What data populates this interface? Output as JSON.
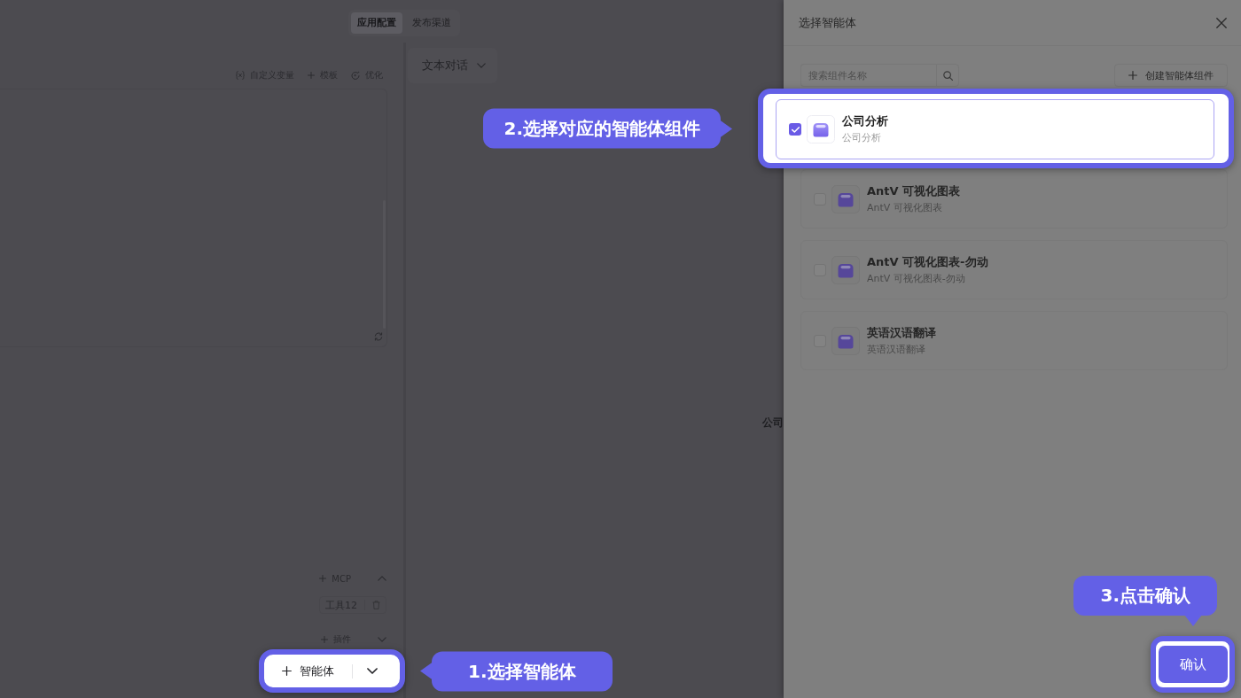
{
  "top_tabs": [
    {
      "label": "应用配置",
      "selected": true
    },
    {
      "label": "发布渠道",
      "selected": false
    }
  ],
  "prompt_panel": {
    "actions": [
      {
        "kind": "variable",
        "label": "自定义变量"
      },
      {
        "kind": "template",
        "label": "模板"
      },
      {
        "kind": "optimize",
        "label": "优化"
      }
    ]
  },
  "tool_groups": [
    {
      "label": "MCP",
      "expanded": true,
      "items": [
        {
          "label": "工具12"
        }
      ]
    },
    {
      "label": "插件",
      "expanded": false
    }
  ],
  "agent_button": {
    "label": "智能体",
    "spotlight": true,
    "guide": {
      "label": "1.选择智能体",
      "kind": "left"
    }
  },
  "chat_panel": {
    "mode": "文本对话",
    "preview_text": "公司"
  },
  "drawer": {
    "title": "选择智能体",
    "search": {
      "placeholder": "搜索组件名称"
    },
    "create_button": "创建智能体组件",
    "items": [
      {
        "name": "公司分析",
        "description": "公司分析",
        "checked": true,
        "spotlight": true,
        "guide": {
          "label": "2.选择对应的智能体组件",
          "kind": "right"
        }
      },
      {
        "name": "AntV 可视化图表",
        "description": "AntV 可视化图表",
        "checked": false,
        "spotlight": false
      },
      {
        "name": "AntV 可视化图表-勿动",
        "description": "AntV 可视化图表-勿动",
        "checked": false,
        "spotlight": false
      },
      {
        "name": "英语汉语翻译",
        "description": "英语汉语翻译",
        "checked": false,
        "spotlight": false
      }
    ],
    "confirm_button": {
      "label": "确认",
      "spotlight": true,
      "guide": {
        "label": "3.点击确认",
        "kind": "down"
      }
    }
  }
}
